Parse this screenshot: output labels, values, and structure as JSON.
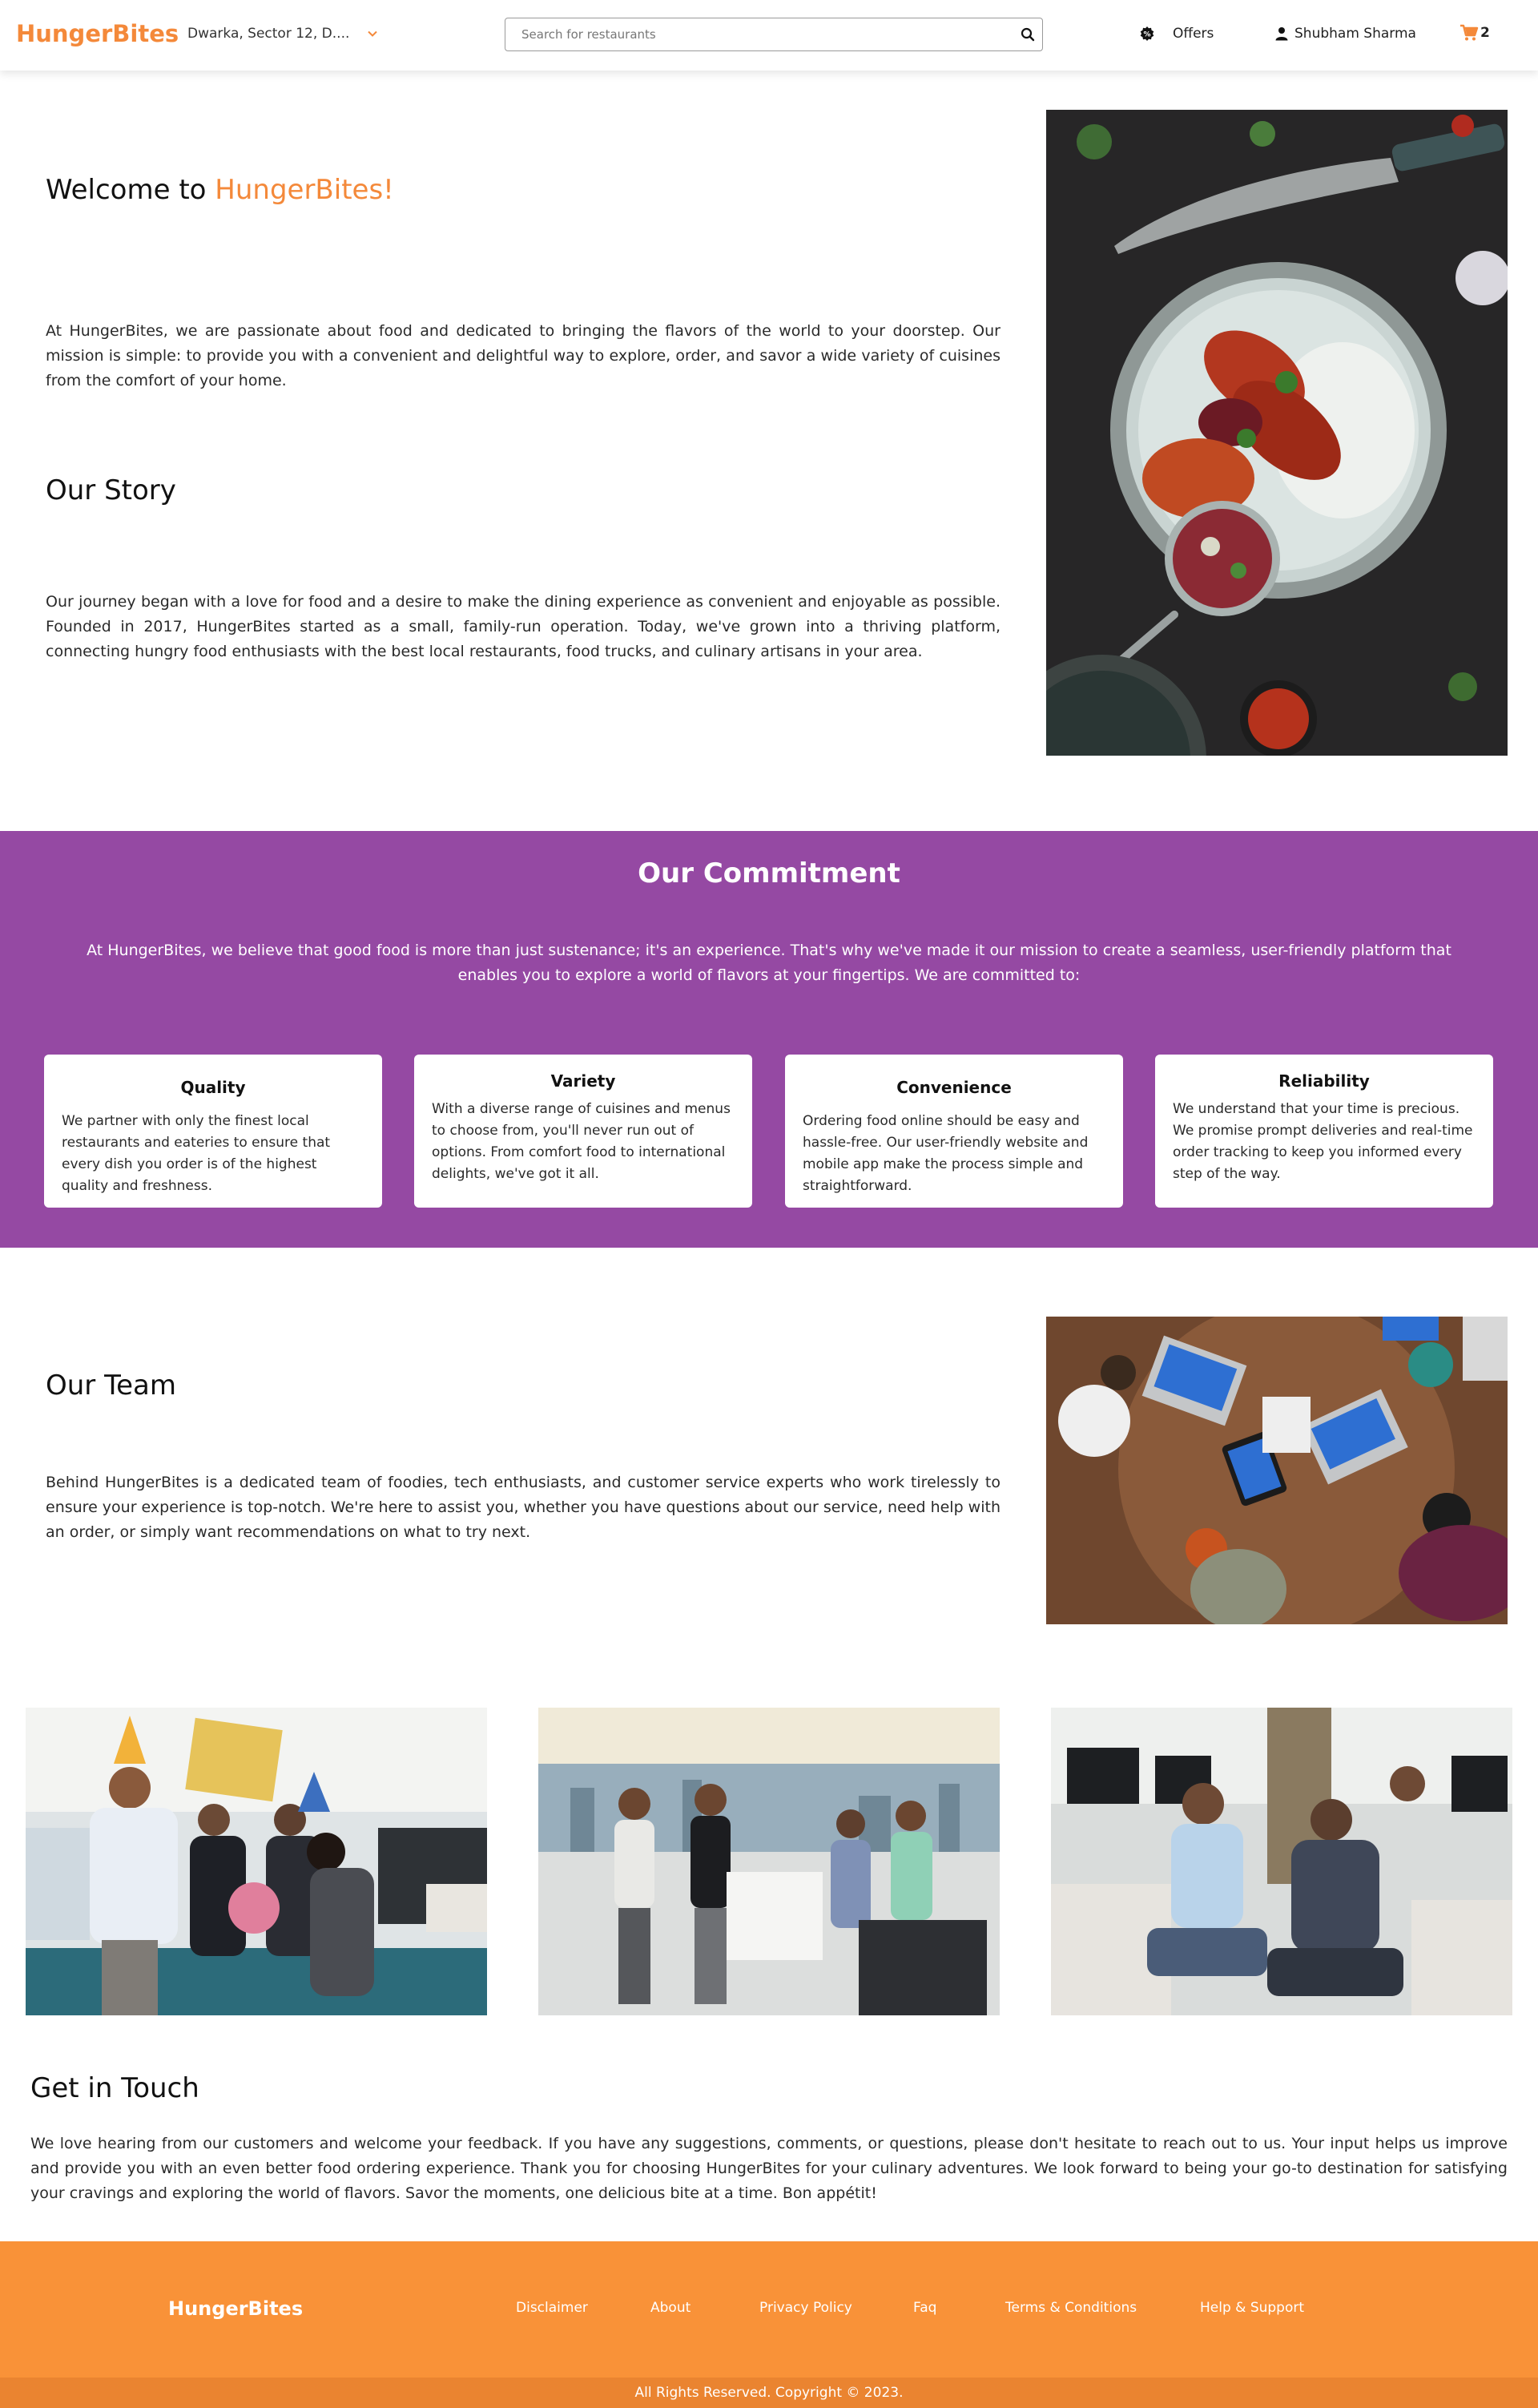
{
  "header": {
    "logo": "HungerBites",
    "location": "Dwarka, Sector 12, D....",
    "search_placeholder": "Search for restaurants",
    "offers_label": "Offers",
    "user_name": "Shubham Sharma",
    "cart_count": "2"
  },
  "about": {
    "welcome_prefix": "Welcome to ",
    "welcome_brand": "HungerBites!",
    "welcome_text": "At HungerBites, we are passionate about food and dedicated to bringing the flavors of the world to your doorstep. Our mission is simple: to provide you with a convenient and delightful way to explore, order, and savor a wide variety of cuisines from the comfort of your home.",
    "story_title": "Our Story",
    "story_text": "Our journey began with a love for food and a desire to make the dining experience as convenient and enjoyable as possible. Founded in 2017, HungerBites started as a small, family-run operation. Today, we've grown into a thriving platform, connecting hungry food enthusiasts with the best local restaurants, food trucks, and culinary artisans in your area."
  },
  "commitment": {
    "title": "Our Commitment",
    "intro": "At HungerBites, we believe that good food is more than just sustenance; it's an experience. That's why we've made it our mission to create a seamless, user-friendly platform that enables you to explore a world of flavors at your fingertips. We are committed to:",
    "cards": [
      {
        "title": "Quality",
        "text": "We partner with only the finest local restaurants and eateries to ensure that every dish you order is of the highest quality and freshness."
      },
      {
        "title": "Variety",
        "text": "With a diverse range of cuisines and menus to choose from, you'll never run out of options. From comfort food to international delights, we've got it all."
      },
      {
        "title": "Convenience",
        "text": "Ordering food online should be easy and hassle-free. Our user-friendly website and mobile app make the process simple and straightforward."
      },
      {
        "title": "Reliability",
        "text": "We understand that your time is precious. We promise prompt deliveries and real-time order tracking to keep you informed every step of the way."
      }
    ]
  },
  "team": {
    "title": "Our Team",
    "text": "Behind HungerBites is a dedicated team of foodies, tech enthusiasts, and customer service experts who work tirelessly to ensure your experience is top-notch. We're here to assist you, whether you have questions about our service, need help with an order, or simply want recommendations on what to try next."
  },
  "contact": {
    "title": "Get in Touch",
    "text": "We love hearing from our customers and welcome your feedback. If you have any suggestions, comments, or questions, please don't hesitate to reach out to us. Your input helps us improve and provide you with an even better food ordering experience. Thank you for choosing HungerBites for your culinary adventures. We look forward to being your go-to destination for satisfying your cravings and exploring the world of flavors. Savor the moments, one delicious bite at a time. Bon appétit!"
  },
  "footer": {
    "logo": "HungerBites",
    "links": [
      "Disclaimer",
      "About",
      "Privacy Policy",
      "Faq",
      "Terms & Conditions",
      "Help & Support"
    ],
    "copyright": "All Rights Reserved. Copyright © 2023."
  },
  "colors": {
    "brand": "#f4893a",
    "commitment_bg": "#9549a3",
    "footer_bg": "#f99238",
    "copyright_bg": "#ea8430"
  }
}
